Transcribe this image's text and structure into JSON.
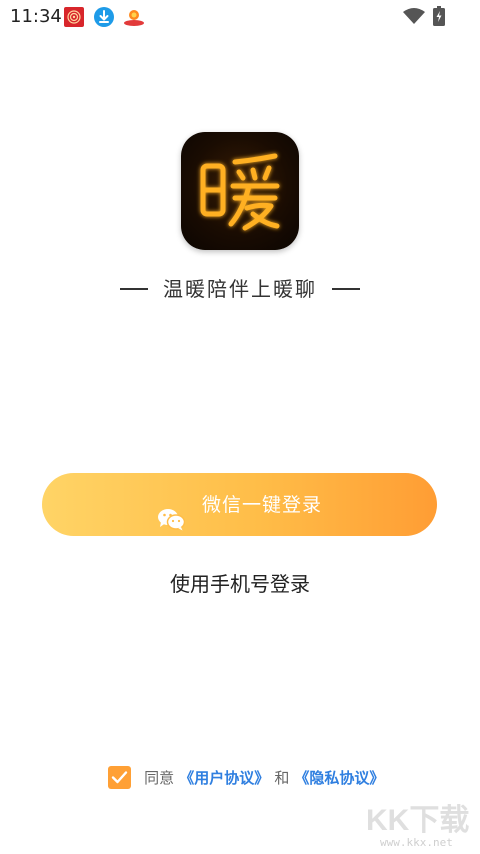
{
  "status_bar": {
    "time": "11:34",
    "icons": [
      "fingerprint-app-icon",
      "download-icon",
      "app-notification-icon",
      "wifi-icon",
      "battery-charging-icon"
    ]
  },
  "logo": {
    "icon": "app-logo-icon",
    "glyph": "暖",
    "colors": {
      "background": "#1a0c02",
      "glyph": "#ffb020"
    }
  },
  "slogan": "温暖陪伴上暖聊",
  "buttons": {
    "wechat_login": "微信一键登录",
    "phone_login": "使用手机号登录"
  },
  "agreement": {
    "checked": true,
    "prefix": "同意",
    "user_agreement": "《用户协议》",
    "conjunction": "和",
    "privacy_agreement": "《隐私协议》"
  },
  "colors": {
    "accent_orange": "#ffa035",
    "gradient_start": "#ffd466",
    "gradient_end": "#ff9d34",
    "link_blue": "#2f7fe0"
  },
  "watermark": {
    "text_main": "KK下载",
    "text_sub": "www.kkx.net"
  }
}
